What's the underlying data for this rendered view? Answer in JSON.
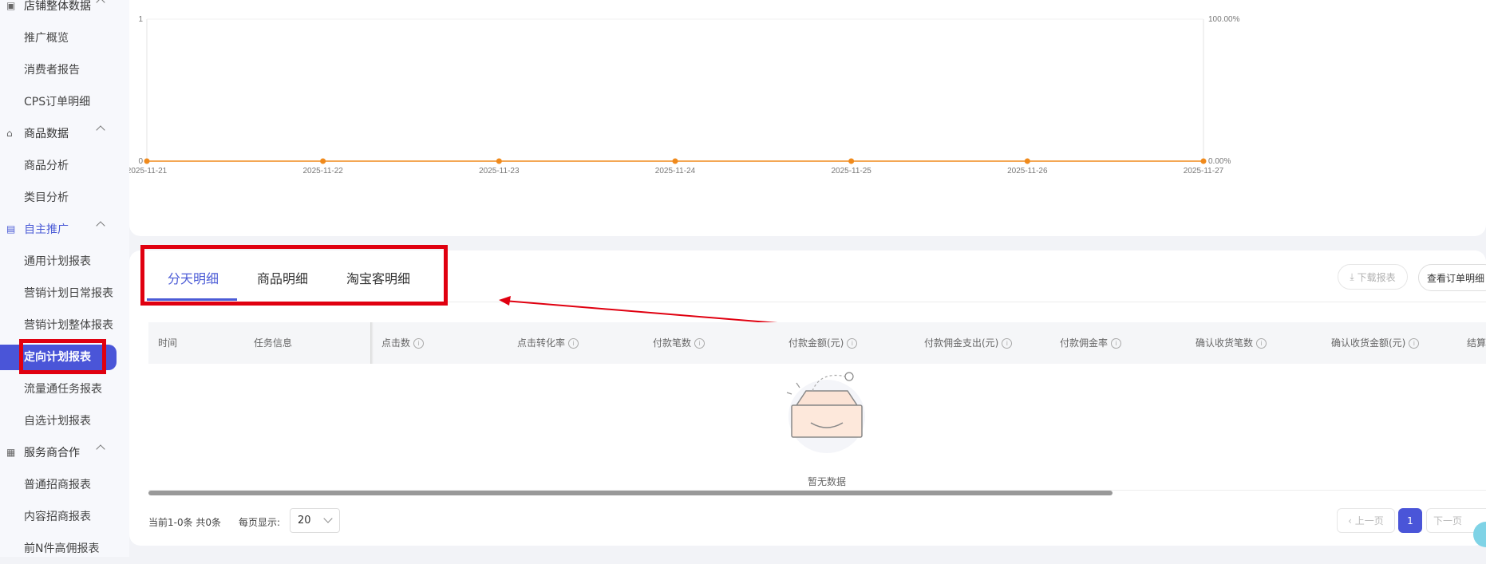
{
  "sidebar": {
    "groups": [
      {
        "label": "店铺整体数据",
        "icon": "store-data-icon",
        "items": [
          "推广概览",
          "消费者报告",
          "CPS订单明细"
        ]
      },
      {
        "label": "商品数据",
        "icon": "bag-icon",
        "items": [
          "商品分析",
          "类目分析"
        ]
      },
      {
        "label": "自主推广",
        "icon": "promotion-icon",
        "items": [
          "通用计划报表",
          "营销计划日常报表",
          "营销计划整体报表",
          "定向计划报表",
          "流量通任务报表",
          "自选计划报表"
        ]
      },
      {
        "label": "服务商合作",
        "icon": "partner-icon",
        "items": [
          "普通招商报表",
          "内容招商报表",
          "前N件高佣报表"
        ]
      }
    ],
    "selected_item": "定向计划报表",
    "active_group": "自主推广"
  },
  "chart_data": {
    "type": "line",
    "x": [
      "2025-11-21",
      "2025-11-22",
      "2025-11-23",
      "2025-11-24",
      "2025-11-25",
      "2025-11-26",
      "2025-11-27"
    ],
    "series": [
      {
        "values": [
          0,
          0,
          0,
          0,
          0,
          0,
          0
        ],
        "color": "#f08a1c"
      }
    ],
    "ylim_left": [
      0,
      1
    ],
    "y_ticks_left": [
      "1",
      "0"
    ],
    "ylim_right": [
      0,
      100
    ],
    "y_ticks_right": [
      "100.00%",
      "0.00%"
    ],
    "grid": false
  },
  "tabs": [
    {
      "label": "分天明细",
      "active": true
    },
    {
      "label": "商品明细",
      "active": false
    },
    {
      "label": "淘宝客明细",
      "active": false
    }
  ],
  "toolbar": {
    "download_label": "下载报表",
    "view_orders_label": "查看订单明细"
  },
  "table": {
    "columns": [
      "时间",
      "任务信息",
      "点击数",
      "点击转化率",
      "付款笔数",
      "付款金额(元)",
      "付款佣金支出(元)",
      "付款佣金率",
      "确认收货笔数",
      "确认收货金额(元)",
      "结算"
    ],
    "rows": [],
    "empty_text": "暂无数据"
  },
  "pagination": {
    "total_text": "当前1-0条 共0条",
    "per_page_label": "每页显示:",
    "per_page_value": "20",
    "prev_label": "上一页",
    "current_page": "1",
    "next_label": "下一页"
  },
  "annotation": {
    "highlight_color": "#e00010"
  }
}
